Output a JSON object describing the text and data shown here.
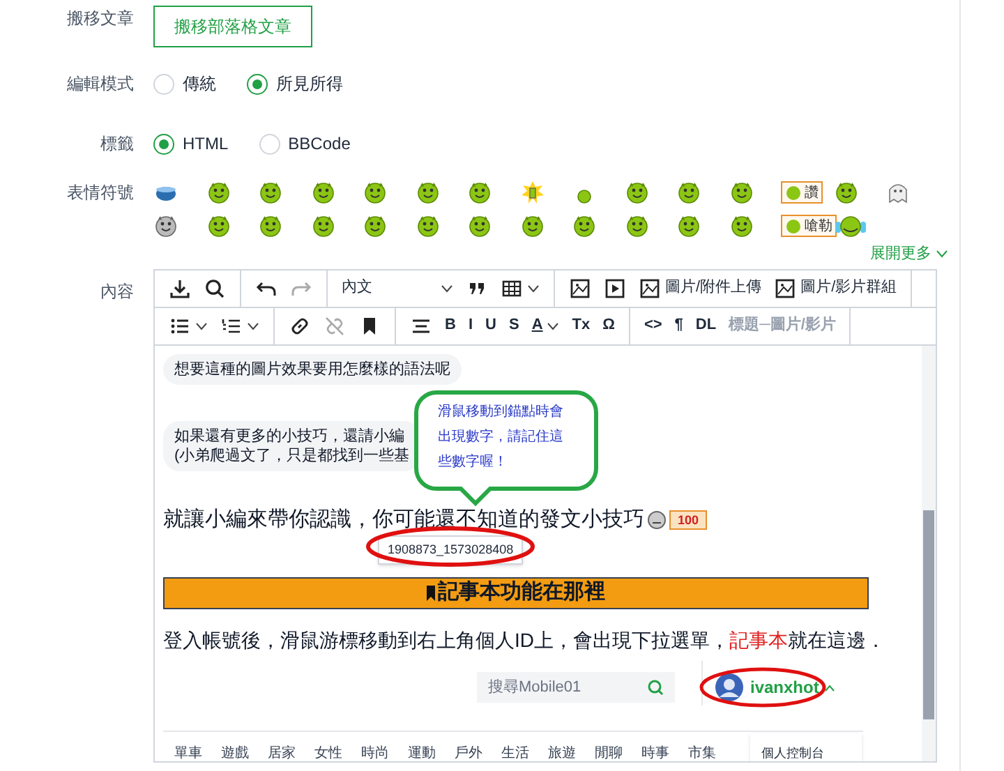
{
  "move_article": {
    "label": "搬移文章",
    "button": "搬移部落格文章"
  },
  "edit_mode": {
    "label": "編輯模式",
    "options": [
      {
        "label": "傳統",
        "selected": false
      },
      {
        "label": "所見所得",
        "selected": true
      }
    ]
  },
  "tags": {
    "label": "標籤",
    "options": [
      {
        "label": "HTML",
        "selected": true
      },
      {
        "label": "BBCode",
        "selected": false
      }
    ]
  },
  "emoticons": {
    "label": "表情符號",
    "items": [
      {
        "kind": "bowl"
      },
      {
        "kind": "face"
      },
      {
        "kind": "face"
      },
      {
        "kind": "face"
      },
      {
        "kind": "face"
      },
      {
        "kind": "face"
      },
      {
        "kind": "face"
      },
      {
        "kind": "flash"
      },
      {
        "kind": "small"
      },
      {
        "kind": "face"
      },
      {
        "kind": "face"
      },
      {
        "kind": "face"
      },
      {
        "kind": "badge",
        "label": "讚"
      },
      {
        "kind": "face"
      },
      {
        "kind": "ghost"
      },
      {
        "kind": "grey"
      },
      {
        "kind": "face"
      },
      {
        "kind": "face"
      },
      {
        "kind": "face"
      },
      {
        "kind": "face"
      },
      {
        "kind": "face"
      },
      {
        "kind": "face"
      },
      {
        "kind": "face"
      },
      {
        "kind": "face"
      },
      {
        "kind": "face"
      },
      {
        "kind": "face"
      },
      {
        "kind": "face"
      },
      {
        "kind": "badge",
        "label": "嗆勒"
      },
      {
        "kind": "crying"
      }
    ],
    "more": "展開更多"
  },
  "content": {
    "label": "內容",
    "toolbar_rows": [
      [
        [
          {
            "kind": "download",
            "disabled": false
          },
          {
            "kind": "search",
            "disabled": false
          }
        ],
        [
          {
            "kind": "undo",
            "disabled": false
          },
          {
            "kind": "redo",
            "disabled": true
          }
        ],
        [
          {
            "kind": "select",
            "label": "內文",
            "disabled": false
          },
          {
            "kind": "quote",
            "disabled": false
          },
          {
            "kind": "table",
            "disabled": false
          }
        ],
        [
          {
            "kind": "image",
            "disabled": false
          },
          {
            "kind": "video",
            "disabled": false
          },
          {
            "kind": "image",
            "label": "圖片/附件上傳",
            "disabled": false
          },
          {
            "kind": "image",
            "label": "圖片/影片群組",
            "disabled": false
          }
        ]
      ],
      [
        [
          {
            "kind": "bullets",
            "disabled": false
          },
          {
            "kind": "numbers",
            "disabled": false
          }
        ],
        [
          {
            "kind": "link",
            "disabled": false
          },
          {
            "kind": "unlink",
            "disabled": true
          },
          {
            "kind": "bookmark",
            "disabled": false
          }
        ],
        [
          {
            "kind": "align",
            "disabled": false
          },
          {
            "kind": "text",
            "label": "B",
            "disabled": false
          },
          {
            "kind": "text",
            "label": "I",
            "disabled": false
          },
          {
            "kind": "text",
            "label": "U",
            "disabled": false
          },
          {
            "kind": "text",
            "label": "S",
            "disabled": false
          },
          {
            "kind": "textcolor",
            "label": "A",
            "disabled": false
          },
          {
            "kind": "text",
            "label": "Tx",
            "disabled": false
          },
          {
            "kind": "text",
            "label": "Ω",
            "disabled": false
          }
        ],
        [
          {
            "kind": "text",
            "label": "<>",
            "disabled": false
          },
          {
            "kind": "text",
            "label": "¶",
            "disabled": false
          },
          {
            "kind": "text",
            "label": "DL",
            "disabled": false
          },
          {
            "kind": "text",
            "label": "標題─圖片/影片",
            "disabled": true
          }
        ]
      ]
    ],
    "bubbles": [
      [
        "想要這種的圖片效果要用怎麼樣的語法呢"
      ],
      [
        "如果還有更多的小技巧，還請小編",
        "(小弟爬過文了，只是都找到一些基"
      ]
    ],
    "callout": "滑鼠移動到錨點時會出現數字，請記住這些數字喔！",
    "intro": "就讓小編來帶你認識，你可能還不知道的發文小技巧",
    "intro_badge": "100",
    "tooltip": "1908873_1573028408",
    "heading": "記事本功能在那裡",
    "sentence": [
      "登入帳號後，滑鼠游標移動到右上角個人ID上，會出現下拉選單，",
      "記事本",
      "就在這邊．"
    ],
    "embedded": {
      "search_placeholder": "搜尋Mobile01",
      "username": "ivanxhot",
      "nav": [
        "單車",
        "遊戲",
        "居家",
        "女性",
        "時尚",
        "運動",
        "戶外",
        "生活",
        "旅遊",
        "閒聊",
        "時事",
        "市集"
      ],
      "menu": [
        "個人控制台"
      ]
    }
  }
}
